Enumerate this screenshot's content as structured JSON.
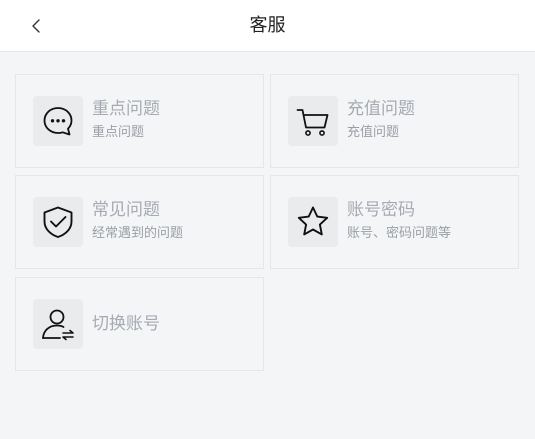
{
  "header": {
    "title": "客服",
    "back_icon": "chevron-left-icon"
  },
  "cards": [
    {
      "title": "重点问题",
      "subtitle": "重点问题",
      "icon": "chat-bubble-icon"
    },
    {
      "title": "充值问题",
      "subtitle": "充值问题",
      "icon": "shopping-cart-icon"
    },
    {
      "title": "常见问题",
      "subtitle": "经常遇到的问题",
      "icon": "shield-check-icon"
    },
    {
      "title": "账号密码",
      "subtitle": "账号、密码问题等",
      "icon": "star-icon"
    },
    {
      "title": "切换账号",
      "subtitle": "",
      "icon": "user-switch-icon"
    }
  ]
}
